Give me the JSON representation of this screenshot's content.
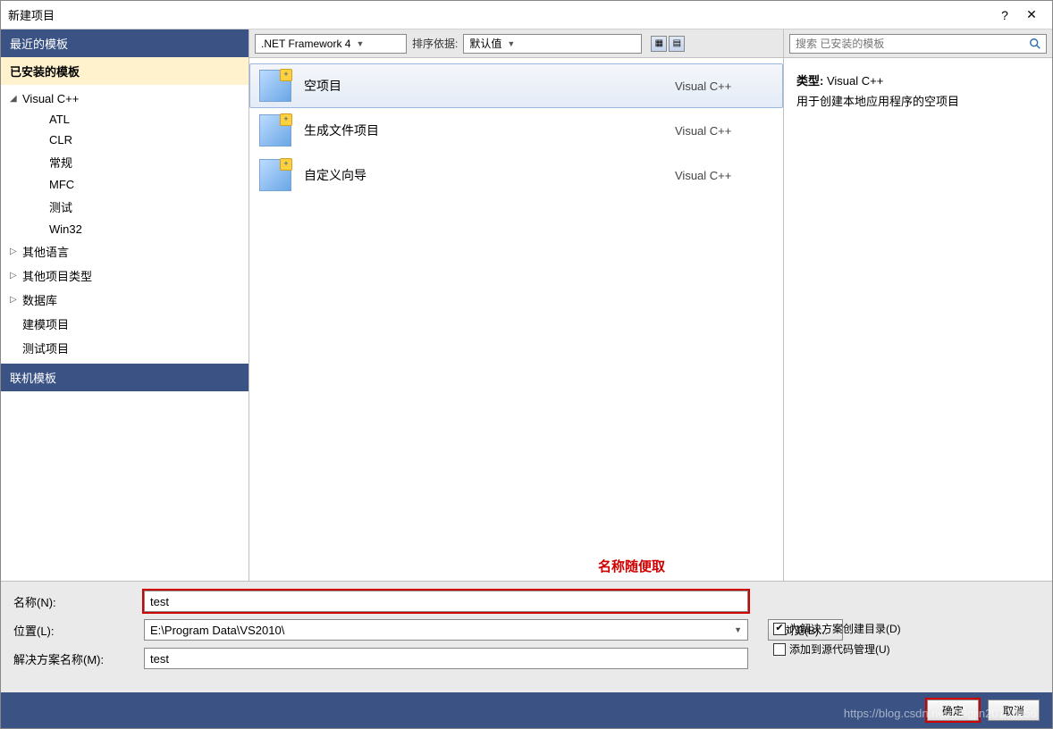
{
  "titlebar": {
    "title": "新建项目",
    "help": "?",
    "close": "✕"
  },
  "sidebar": {
    "headers": {
      "recent": "最近的模板",
      "installed": "已安装的模板",
      "online": "联机模板"
    },
    "tree": {
      "root": "Visual C++",
      "children": [
        "ATL",
        "CLR",
        "常规",
        "MFC",
        "测试",
        "Win32"
      ],
      "siblings": [
        "其他语言",
        "其他项目类型",
        "数据库",
        "建模项目",
        "测试项目"
      ]
    }
  },
  "toolbar": {
    "framework": ".NET Framework 4",
    "sort_label": "排序依据:",
    "sort_value": "默认值"
  },
  "search": {
    "placeholder": "搜索 已安装的模板"
  },
  "templates": [
    {
      "name": "空项目",
      "lang": "Visual C++",
      "selected": true
    },
    {
      "name": "生成文件项目",
      "lang": "Visual C++",
      "selected": false
    },
    {
      "name": "自定义向导",
      "lang": "Visual C++",
      "selected": false
    }
  ],
  "annotation": "名称随便取",
  "info": {
    "type_label": "类型:",
    "type_value": "Visual C++",
    "desc": "用于创建本地应用程序的空项目"
  },
  "form": {
    "name_label": "名称(N):",
    "name_value": "test",
    "location_label": "位置(L):",
    "location_value": "E:\\Program Data\\VS2010\\",
    "browse": "浏览(B)...",
    "solution_label": "解决方案名称(M):",
    "solution_value": "test",
    "create_dir": "为解决方案创建目录(D)",
    "add_scc": "添加到源代码管理(U)"
  },
  "footer": {
    "ok": "确定",
    "cancel": "取消"
  },
  "watermark": "https://blog.csdn.net/tangjin20102056"
}
